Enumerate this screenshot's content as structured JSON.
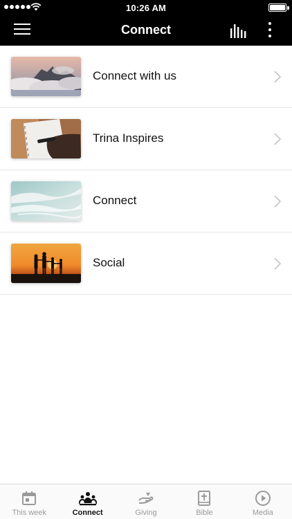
{
  "status_bar": {
    "time": "10:26 AM"
  },
  "nav": {
    "title": "Connect"
  },
  "list": [
    {
      "label": "Connect with us",
      "image": "mountains-above-clouds"
    },
    {
      "label": "Trina Inspires",
      "image": "hand-writing-in-notebook"
    },
    {
      "label": "Connect",
      "image": "ocean-waves-shore"
    },
    {
      "label": "Social",
      "image": "family-silhouette-sunset"
    }
  ],
  "tabs": [
    {
      "label": "This week",
      "icon": "calendar-icon",
      "active": false
    },
    {
      "label": "Connect",
      "icon": "people-icon",
      "active": true
    },
    {
      "label": "Giving",
      "icon": "giving-hand-icon",
      "active": false
    },
    {
      "label": "Bible",
      "icon": "bible-icon",
      "active": false
    },
    {
      "label": "Media",
      "icon": "play-icon",
      "active": false
    }
  ],
  "colors": {
    "header": "#000000",
    "tab_active": "#111111",
    "tab_inactive": "#9a9a9a",
    "divider": "#e6e6e6"
  }
}
